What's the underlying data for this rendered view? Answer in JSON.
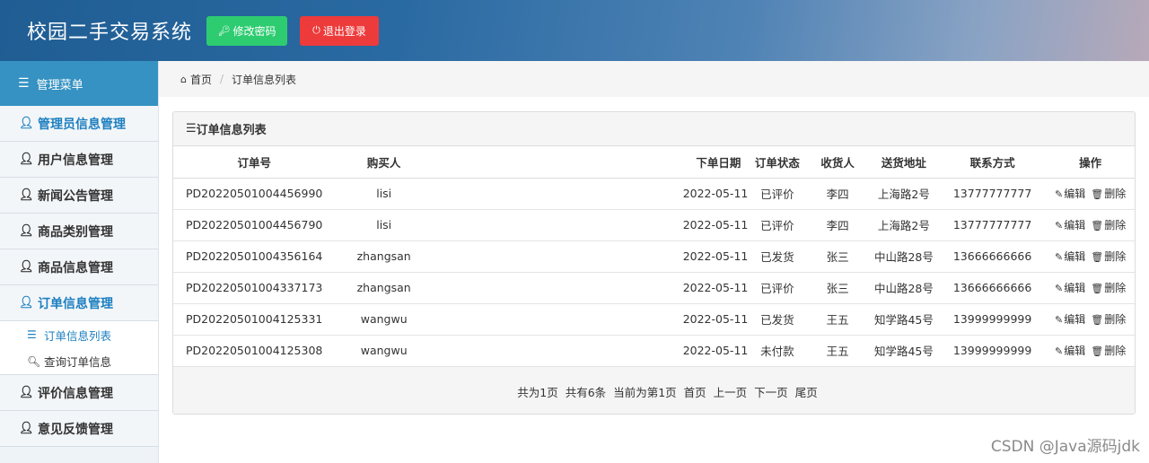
{
  "header": {
    "title": "校园二手交易系统",
    "edit_password": "修改密码",
    "logout": "退出登录"
  },
  "sidebar": {
    "top_label": "管理菜单",
    "items": [
      {
        "label": "管理员信息管理"
      },
      {
        "label": "用户信息管理"
      },
      {
        "label": "新闻公告管理"
      },
      {
        "label": "商品类别管理"
      },
      {
        "label": "商品信息管理"
      },
      {
        "label": "订单信息管理"
      },
      {
        "label": "评价信息管理"
      },
      {
        "label": "意见反馈管理"
      }
    ],
    "sub_items": [
      {
        "label": "订单信息列表"
      },
      {
        "label": "查询订单信息"
      }
    ]
  },
  "breadcrumb": {
    "home": "首页",
    "current": "订单信息列表"
  },
  "panel": {
    "title": "订单信息列表"
  },
  "table": {
    "columns": [
      "订单号",
      "购买人",
      "下单日期",
      "订单状态",
      "收货人",
      "送货地址",
      "联系方式",
      "操作"
    ],
    "rows": [
      {
        "order_no": "PD20220501004456990",
        "buyer": "lisi",
        "date": "2022-05-11",
        "status": "已评价",
        "receiver": "李四",
        "address": "上海路2号",
        "phone": "13777777777"
      },
      {
        "order_no": "PD20220501004456790",
        "buyer": "lisi",
        "date": "2022-05-11",
        "status": "已评价",
        "receiver": "李四",
        "address": "上海路2号",
        "phone": "13777777777"
      },
      {
        "order_no": "PD20220501004356164",
        "buyer": "zhangsan",
        "date": "2022-05-11",
        "status": "已发货",
        "receiver": "张三",
        "address": "中山路28号",
        "phone": "13666666666"
      },
      {
        "order_no": "PD20220501004337173",
        "buyer": "zhangsan",
        "date": "2022-05-11",
        "status": "已评价",
        "receiver": "张三",
        "address": "中山路28号",
        "phone": "13666666666"
      },
      {
        "order_no": "PD20220501004125331",
        "buyer": "wangwu",
        "date": "2022-05-11",
        "status": "已发货",
        "receiver": "王五",
        "address": "知学路45号",
        "phone": "13999999999"
      },
      {
        "order_no": "PD20220501004125308",
        "buyer": "wangwu",
        "date": "2022-05-11",
        "status": "未付款",
        "receiver": "王五",
        "address": "知学路45号",
        "phone": "13999999999"
      }
    ],
    "edit_label": "编辑",
    "delete_label": "删除"
  },
  "pager": {
    "total_pages": "共为1页",
    "total_items": "共有6条",
    "current_page": "当前为第1页",
    "first": "首页",
    "prev": "上一页",
    "next": "下一页",
    "last": "尾页"
  },
  "watermark": "CSDN @Java源码jdk",
  "icons": {
    "key": "key-icon",
    "power": "power-icon",
    "menu": "list-icon",
    "user": "user-icon",
    "home": "home-icon",
    "search": "search-icon",
    "edit": "edit-icon",
    "trash": "trash-icon"
  },
  "colors": {
    "accent_blue": "#1d7fc0",
    "green_button": "#2ecc71",
    "red_button": "#ed3b3b",
    "sidebar_top": "#3592c2"
  }
}
